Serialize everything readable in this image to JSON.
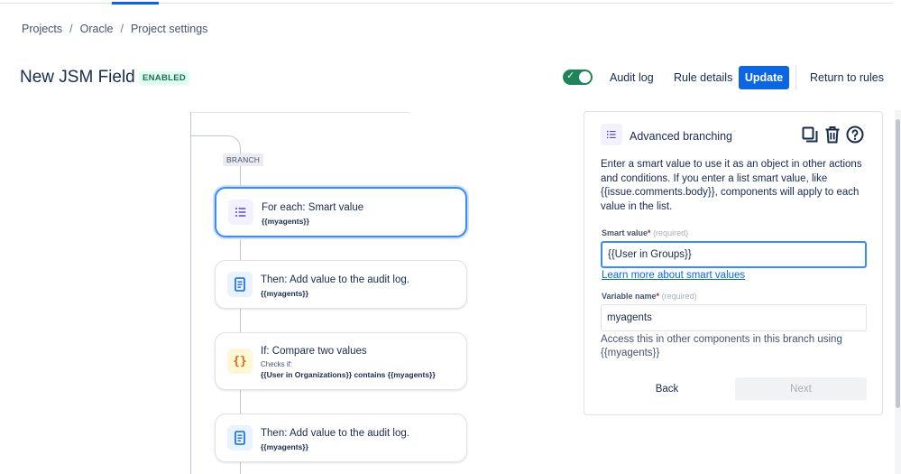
{
  "breadcrumb": [
    "Projects",
    "Oracle",
    "Project settings"
  ],
  "rule": {
    "title": "New JSM Field",
    "status": "ENABLED",
    "enabled": true
  },
  "header": {
    "audit_log": "Audit log",
    "rule_details": "Rule details",
    "update": "Update",
    "return": "Return to rules"
  },
  "flow": {
    "branch_label": "BRANCH",
    "cards": [
      {
        "title": "For each: Smart value",
        "detail": "{{myagents}}",
        "icon": "list-icon",
        "selected": true
      },
      {
        "title": "Then: Add value to the audit log.",
        "detail": "{{myagents}}",
        "icon": "document-icon"
      },
      {
        "title": "If: Compare two values",
        "sub": "Checks if:",
        "detail": "{{User in Organizations}} contains {{myagents}}",
        "icon": "curly-braces-icon"
      },
      {
        "title": "Then: Add value to the audit log.",
        "detail": "{{myagents}}",
        "icon": "document-icon"
      }
    ]
  },
  "panel": {
    "title": "Advanced branching",
    "description": "Enter a smart value to use it as an object in other actions and conditions. If you enter a list smart value, like {{issue.comments.body}}, components will apply to each value in the list.",
    "smart_value_label": "Smart value",
    "smart_value": "{{User in Groups}}",
    "learn_more": "Learn more about smart values",
    "variable_label": "Variable name",
    "variable_value": "myagents",
    "required_text": "(required)",
    "required_star": "*",
    "helper": "Access this in other components in this branch using {{myagents}}",
    "back": "Back",
    "next": "Next"
  },
  "colors": {
    "primary": "#0c66e4",
    "success": "#1f845a",
    "selected_border": "#388bff",
    "icon_purple": "#5e4db2",
    "icon_blue": "#0c66e4",
    "icon_orange": "#e56910"
  }
}
